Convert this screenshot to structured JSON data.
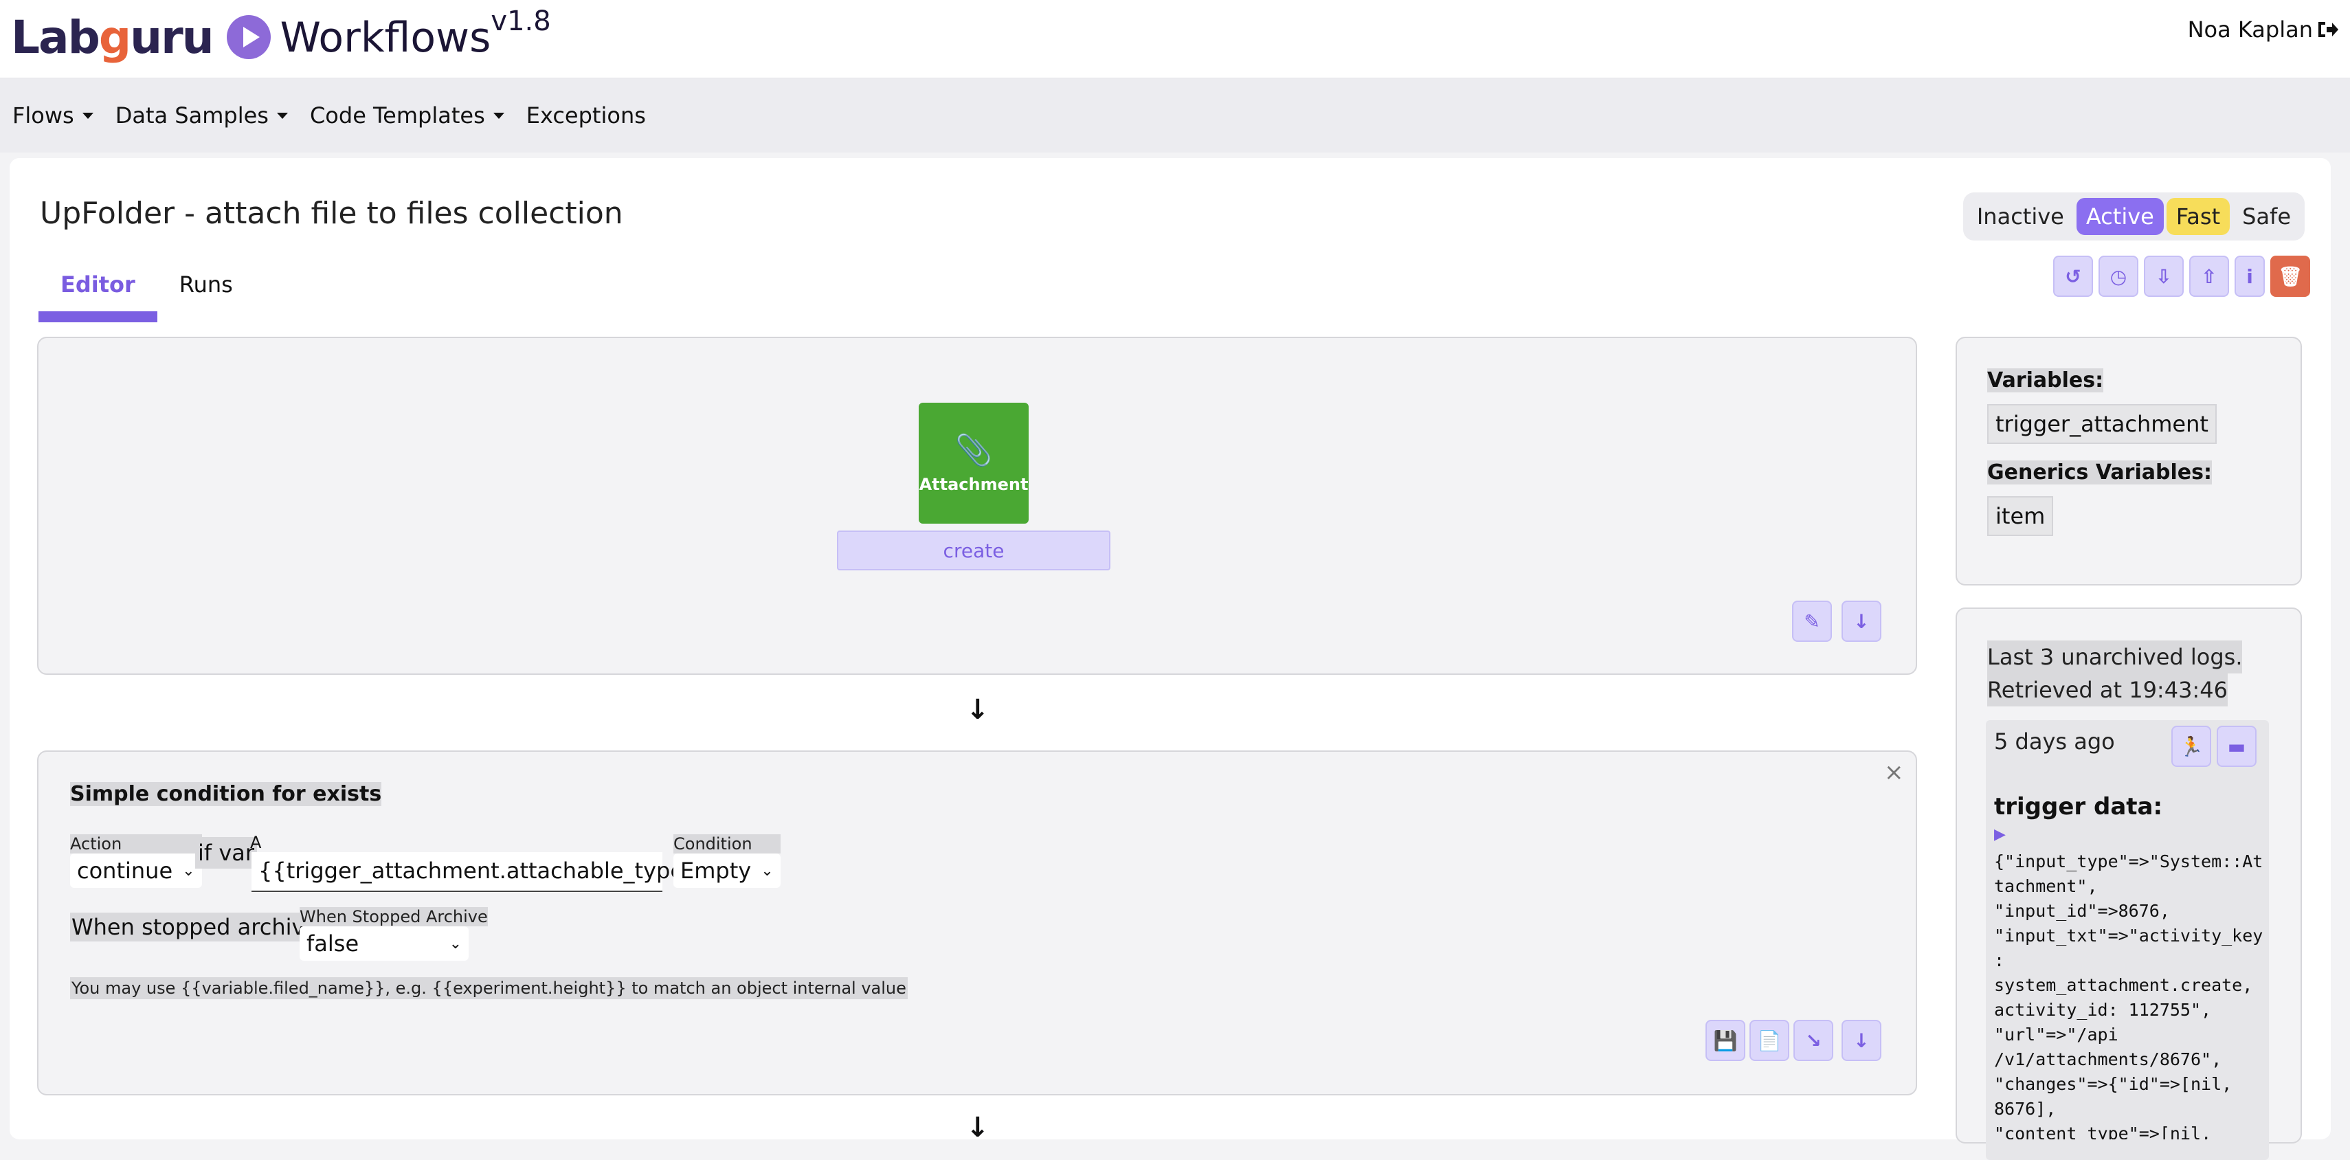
{
  "header": {
    "brand_pre": "Lab",
    "brand_g": "g",
    "brand_post": "uru",
    "product": "Workflows",
    "version": "v1.8",
    "user_name": "Noa Kaplan"
  },
  "nav": {
    "items": [
      {
        "label": "Flows",
        "dropdown": true
      },
      {
        "label": "Data Samples",
        "dropdown": true
      },
      {
        "label": "Code Templates",
        "dropdown": true
      },
      {
        "label": "Exceptions",
        "dropdown": false
      }
    ]
  },
  "flow": {
    "title": "UpFolder - attach file to files collection",
    "tabs": [
      "Editor",
      "Runs"
    ],
    "active_tab": "Editor",
    "toggle_state": [
      "Inactive",
      "Active"
    ],
    "toggle_mode": [
      "Fast",
      "Safe"
    ]
  },
  "trigger_node": {
    "label": "Attachment",
    "action": "create"
  },
  "condition": {
    "title": "Simple condition for exists",
    "action_label": "Action",
    "action_value": "continue",
    "if_var": "if var",
    "a_label": "A",
    "a_value": "{{trigger_attachment.attachable_type}}",
    "condition_label": "Condition",
    "condition_value": "Empty",
    "when_stopped_q": "When stopped archive?",
    "when_stopped_label": "When Stopped Archive",
    "when_stopped_value": "false",
    "note": "You may use {{variable.filed_name}}, e.g. {{experiment.height}} to match an object internal value"
  },
  "variables": {
    "heading": "Variables:",
    "items": [
      "trigger_attachment"
    ],
    "generics_heading": "Generics Variables:",
    "generics": [
      "item"
    ]
  },
  "logs": {
    "line1": "Last 3 unarchived logs.",
    "line2": "Retrieved at 19:43:46",
    "entry_time": "5 days ago",
    "trigger_heading": "trigger data:",
    "expander": "▶",
    "data_lines": [
      "{\"input_type\"=>\"System::At",
      "tachment\",",
      "\"input_id\"=>8676,",
      "\"input_txt\"=>\"activity_key",
      ":",
      "system_attachment.create,",
      "activity_id: 112755\",",
      "\"url\"=>\"/api",
      "/v1/attachments/8676\",",
      "\"changes\"=>{\"id\"=>[nil,",
      "8676],",
      "\"content_type\"=>[nil,"
    ]
  },
  "colors": {
    "accent": "#7b5fe2",
    "node_green": "#4aa833",
    "danger": "#e06a4c",
    "fast_yellow": "#f7dd5a"
  }
}
